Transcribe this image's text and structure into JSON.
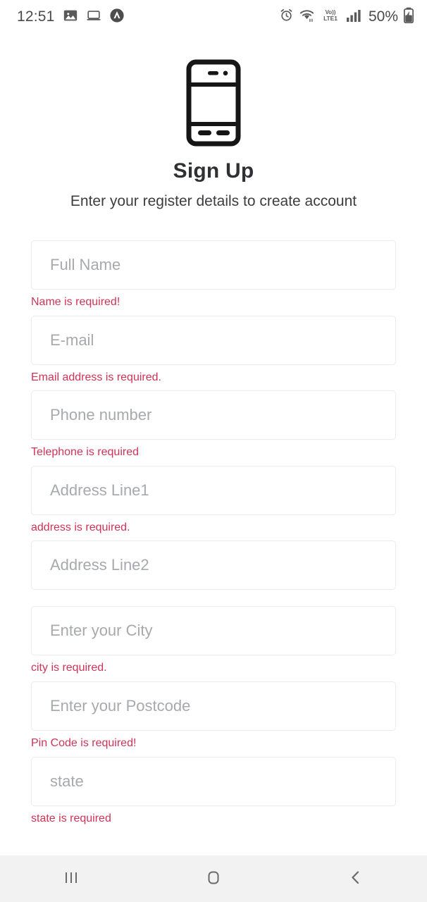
{
  "status_bar": {
    "time": "12:51",
    "left_icons": [
      "image-icon",
      "laptop-icon",
      "app-badge-icon"
    ],
    "right_icons": [
      "alarm-icon",
      "wifi-icon",
      "volte-lte-icon",
      "signal-bars-icon"
    ],
    "volte_label": "Vo))",
    "lte_label": "LTE1",
    "battery_percent": "50%",
    "battery_state": "charging"
  },
  "header": {
    "illustration": "mobile-phone-icon",
    "title": "Sign Up",
    "subtitle": "Enter your register details to create account"
  },
  "form": {
    "fields": [
      {
        "name": "full-name",
        "placeholder": "Full Name",
        "value": "",
        "error": "Name is required!"
      },
      {
        "name": "email",
        "placeholder": "E-mail",
        "value": "",
        "error": "Email address is required."
      },
      {
        "name": "phone",
        "placeholder": "Phone number",
        "value": "",
        "error": "Telephone is required"
      },
      {
        "name": "address-line1",
        "placeholder": "Address Line1",
        "value": "",
        "error": "address is required."
      },
      {
        "name": "address-line2",
        "placeholder": "Address Line2",
        "value": "",
        "error": ""
      },
      {
        "name": "city",
        "placeholder": "Enter your City",
        "value": "",
        "error": "city is required."
      },
      {
        "name": "postcode",
        "placeholder": "Enter your Postcode",
        "value": "",
        "error": "Pin Code is required!"
      },
      {
        "name": "state",
        "placeholder": "state",
        "value": "",
        "error": "state is required"
      }
    ]
  },
  "nav_bar": {
    "buttons": [
      {
        "name": "recents-button",
        "icon": "recents-icon"
      },
      {
        "name": "home-button",
        "icon": "home-icon"
      },
      {
        "name": "back-button",
        "icon": "back-chevron-icon"
      }
    ]
  },
  "colors": {
    "error": "#cf3356",
    "placeholder": "#a7a9ad",
    "title": "#2f3034",
    "border": "#ececee",
    "navbar_bg": "#f2f2f2"
  }
}
